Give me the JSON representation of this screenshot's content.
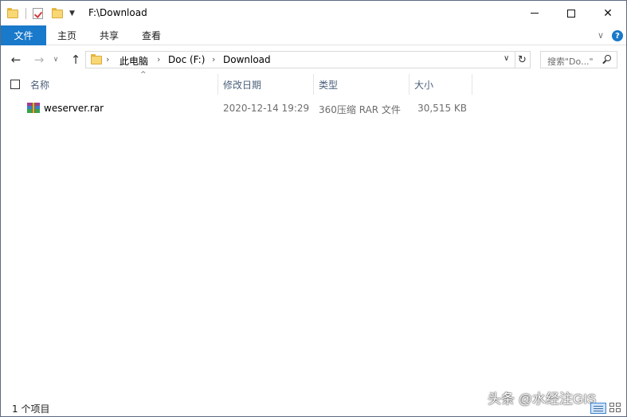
{
  "window": {
    "title": "F:\\Download",
    "controls": {
      "minimize": "minimize-icon",
      "maximize": "maximize-icon",
      "close": "✕"
    }
  },
  "ribbon": {
    "tabs": [
      {
        "label": "文件",
        "active": true
      },
      {
        "label": "主页"
      },
      {
        "label": "共享"
      },
      {
        "label": "查看"
      }
    ],
    "help": "?"
  },
  "nav": {
    "back": "←",
    "forward": "→",
    "recent": "∨",
    "up": "↑",
    "breadcrumb": [
      "此电脑",
      "Doc (F:)",
      "Download"
    ],
    "separator": "›",
    "refresh": "↻"
  },
  "search": {
    "placeholder": "搜索\"Do...\""
  },
  "columns": {
    "name": "名称",
    "date": "修改日期",
    "type": "类型",
    "size": "大小"
  },
  "files": [
    {
      "name": "weserver.rar",
      "date": "2020-12-14 19:29",
      "type": "360压缩 RAR 文件",
      "size": "30,515 KB"
    }
  ],
  "status": {
    "count": "1 个项目"
  },
  "watermark": "头条 @水经注GIS",
  "colors": {
    "accent": "#1979ca",
    "header_text": "#4c607a",
    "muted_text": "#6d6d6d"
  }
}
